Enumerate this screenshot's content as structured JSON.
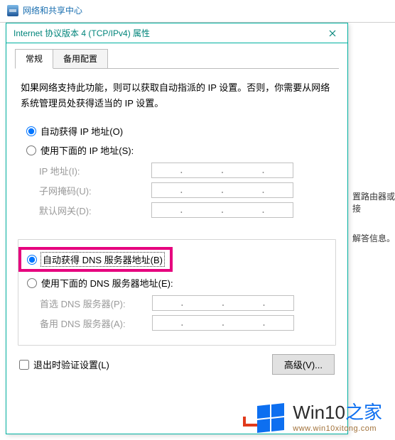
{
  "background": {
    "header_link": "网络和共享中心",
    "side_text_1": "置路由器或接",
    "side_text_2": "解答信息。"
  },
  "dialog": {
    "title": "Internet 协议版本 4 (TCP/IPv4) 属性",
    "tabs": [
      "常规",
      "备用配置"
    ],
    "active_tab": 0,
    "intro": "如果网络支持此功能，则可以获取自动指派的 IP 设置。否则，你需要从网络系统管理员处获得适当的 IP 设置。",
    "ip_group": {
      "auto_label": "自动获得 IP 地址(O)",
      "manual_label": "使用下面的 IP 地址(S):",
      "selected": "auto",
      "fields": {
        "ip": "IP 地址(I):",
        "mask": "子网掩码(U):",
        "gateway": "默认网关(D):"
      }
    },
    "dns_group": {
      "auto_label": "自动获得 DNS 服务器地址(B)",
      "manual_label": "使用下面的 DNS 服务器地址(E):",
      "selected": "auto",
      "fields": {
        "preferred": "首选 DNS 服务器(P):",
        "alternate": "备用 DNS 服务器(A):"
      }
    },
    "validate_on_exit": "退出时验证设置(L)",
    "advanced_button": "高级(V)..."
  },
  "watermark": {
    "brand_a": "Win10",
    "brand_b": "之家",
    "url": "www.win10xitong.com"
  }
}
